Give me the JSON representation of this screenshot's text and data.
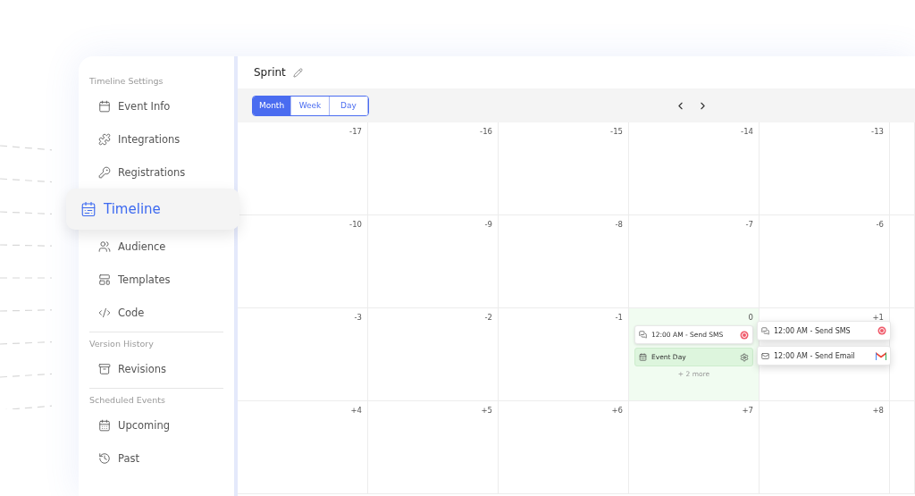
{
  "sidebar": {
    "sections": [
      {
        "title": "Timeline Settings",
        "items": [
          {
            "label": "Event Info",
            "selected": false
          },
          {
            "label": "Integrations",
            "selected": false
          },
          {
            "label": "Registrations",
            "selected": false
          },
          {
            "label": "Timeline",
            "selected": true
          },
          {
            "label": "Audience",
            "selected": false
          },
          {
            "label": "Templates",
            "selected": false
          },
          {
            "label": "Code",
            "selected": false
          }
        ]
      },
      {
        "title": "Version History",
        "items": [
          {
            "label": "Revisions",
            "selected": false
          }
        ]
      },
      {
        "title": "Scheduled Events",
        "items": [
          {
            "label": "Upcoming",
            "selected": false
          },
          {
            "label": "Past",
            "selected": false
          }
        ]
      }
    ]
  },
  "header": {
    "title": "Sprint"
  },
  "view_tabs": [
    {
      "label": "Month",
      "selected": true
    },
    {
      "label": "Week",
      "selected": false
    },
    {
      "label": "Day",
      "selected": false
    }
  ],
  "calendar": {
    "weeks": [
      [
        {
          "label": "-17",
          "today": false
        },
        {
          "label": "-16",
          "today": false
        },
        {
          "label": "-15",
          "today": false
        },
        {
          "label": "-14",
          "today": false
        },
        {
          "label": "-13",
          "today": false
        }
      ],
      [
        {
          "label": "-10",
          "today": false
        },
        {
          "label": "-9",
          "today": false
        },
        {
          "label": "-8",
          "today": false
        },
        {
          "label": "-7",
          "today": false
        },
        {
          "label": "-6",
          "today": false
        }
      ],
      [
        {
          "label": "-3",
          "today": false
        },
        {
          "label": "-2",
          "today": false
        },
        {
          "label": "-1",
          "today": false
        },
        {
          "label": "0",
          "today": true,
          "events": [
            {
              "kind": "sms",
              "text": "12:00 AM - Send SMS"
            },
            {
              "kind": "event-day",
              "text": "Event Day"
            }
          ],
          "more": "+ 2 more"
        },
        {
          "label": "+1",
          "today": false,
          "popover": [
            {
              "kind": "sms",
              "text": "12:00 AM - Send SMS"
            },
            {
              "kind": "email",
              "text": "12:00 AM - Send Email"
            }
          ]
        }
      ],
      [
        {
          "label": "+4",
          "today": false
        },
        {
          "label": "+5",
          "today": false
        },
        {
          "label": "+6",
          "today": false
        },
        {
          "label": "+7",
          "today": false
        },
        {
          "label": "+8",
          "today": false
        }
      ]
    ]
  }
}
